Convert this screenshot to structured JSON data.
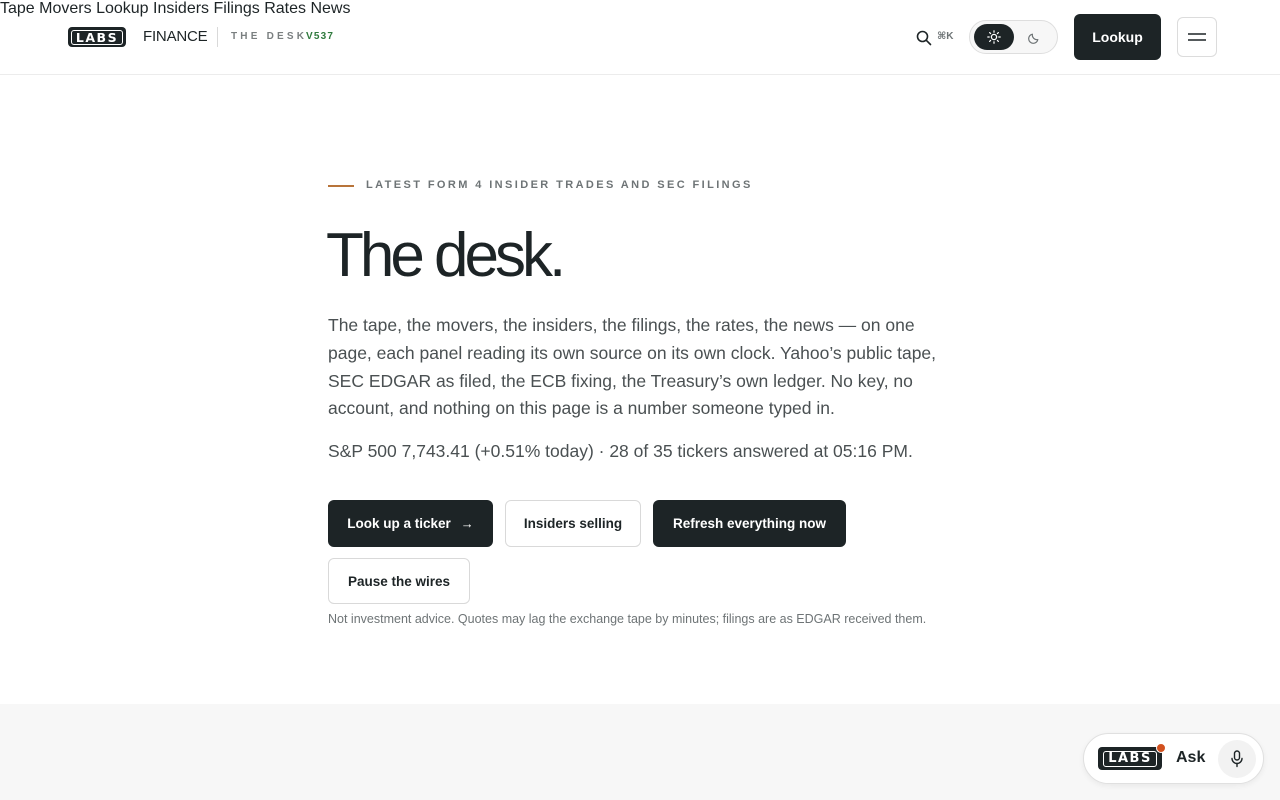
{
  "header": {
    "logo_text": "LABS",
    "brand": "FINANCE",
    "desk_tag": "THE DESK",
    "version": "V537",
    "nav": [
      "Tape",
      "Movers",
      "Lookup",
      "Insiders",
      "Filings",
      "Rates",
      "News"
    ],
    "search_shortcut": "⌘K",
    "theme": {
      "selected": "light",
      "options": [
        "light",
        "dark"
      ]
    },
    "lookup_label": "Lookup"
  },
  "hero": {
    "eyebrow": "LATEST FORM 4 INSIDER TRADES AND SEC FILINGS",
    "title": "The desk.",
    "lede": "The tape, the movers, the insiders, the filings, the rates, the news — on one page, each panel reading its own source on its own clock. Yahoo’s public tape, SEC EDGAR as filed, the ECB fixing, the Treasury’s own ledger. No key, no account, and nothing on this page is a number someone typed in.",
    "status": "S&P 500 7,743.41 (+0.51% today) · 28 of 35 tickers answered at 05:16 PM.",
    "buttons": {
      "lookup_ticker": "Look up a ticker",
      "insiders_selling": "Insiders selling",
      "refresh": "Refresh everything now",
      "pause": "Pause the wires"
    },
    "disclaimer": "Not investment advice. Quotes may lag the exchange tape by minutes; filings are as EDGAR received them."
  },
  "ask_widget": {
    "logo_text": "LABS",
    "label": "Ask"
  },
  "colors": {
    "ink": "#1d2426",
    "accent_line": "#b8743a",
    "version_green": "#2f7a3d",
    "notification_dot": "#d2511f"
  }
}
